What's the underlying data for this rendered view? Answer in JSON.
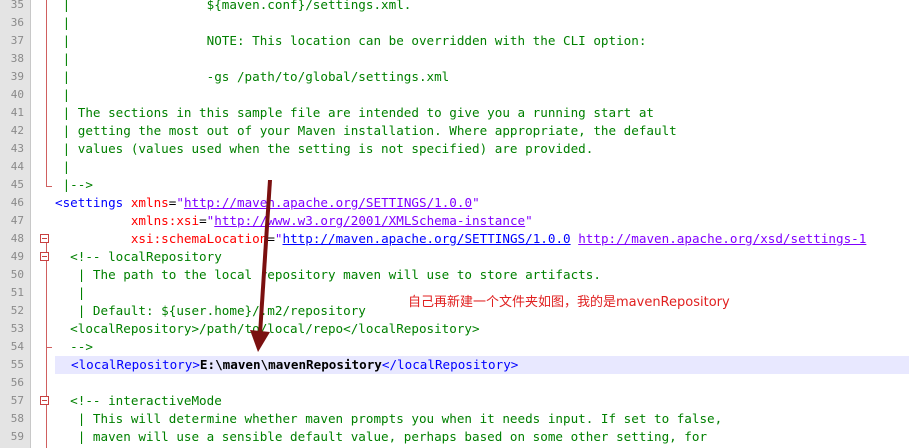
{
  "gutter": {
    "line_numbers": [
      "35",
      "36",
      "37",
      "38",
      "39",
      "40",
      "41",
      "42",
      "43",
      "44",
      "45",
      "46",
      "47",
      "48",
      "49",
      "50",
      "51",
      "52",
      "53",
      "54",
      "55",
      "56",
      "57",
      "58",
      "59"
    ]
  },
  "code": {
    "l35": " |                  ${maven.conf}/settings.xml.",
    "l36": " |",
    "l37": " |                  NOTE: This location can be overridden with the CLI option:",
    "l38": " |",
    "l39": " |                  -gs /path/to/global/settings.xml",
    "l40": " |",
    "l41": " | The sections in this sample file are intended to give you a running start at",
    "l42": " | getting the most out of your Maven installation. Where appropriate, the default",
    "l43": " | values (values used when the setting is not specified) are provided.",
    "l44": " |",
    "l45": " |-->",
    "l46_open": "<settings ",
    "l46_attr": "xmlns",
    "l46_eq": "=",
    "l46_val": "\"http://maven.apache.org/SETTINGS/1.0.0\"",
    "l47_indent": "          ",
    "l47_attr": "xmlns:xsi",
    "l47_eq": "=",
    "l47_val": "\"http://www.w3.org/2001/XMLSchema-instance\"",
    "l48_indent": "          ",
    "l48_attr": "xsi:schemaLocation",
    "l48_eq": "=",
    "l48_val1": "\"http://maven.apache.org/SETTINGS/1.0.0",
    "l48_sp": " ",
    "l48_val2": "http://maven.apache.org/xsd/settings-1",
    "l49": "  <!-- localRepository",
    "l50": "   | The path to the local repository maven will use to store artifacts.",
    "l51": "   |",
    "l52": "   | Default: ${user.home}/.m2/repository",
    "l53": "  <localRepository>/path/to/local/repo</localRepository>",
    "l54": "  -->",
    "l55_open": "<localRepository>",
    "l55_value": "E:\\maven\\mavenRepository",
    "l55_close": "</localRepository>",
    "l57": "  <!-- interactiveMode",
    "l58": "   | This will determine whether maven prompts you when it needs input. If set to false,",
    "l59": "   | maven will use a sensible default value, perhaps based on some other setting, for"
  },
  "annotation": {
    "text": "自己再新建一个文件夹如图，我的是mavenRepository",
    "color": "#e02020"
  },
  "colors": {
    "comment": "#008000",
    "tag": "#0000ff",
    "attribute": "#ff0000",
    "value": "#8000ff",
    "current_line": "#e8e8ff",
    "gutter": "#e4e4e4",
    "arrow": "#7a1010"
  }
}
